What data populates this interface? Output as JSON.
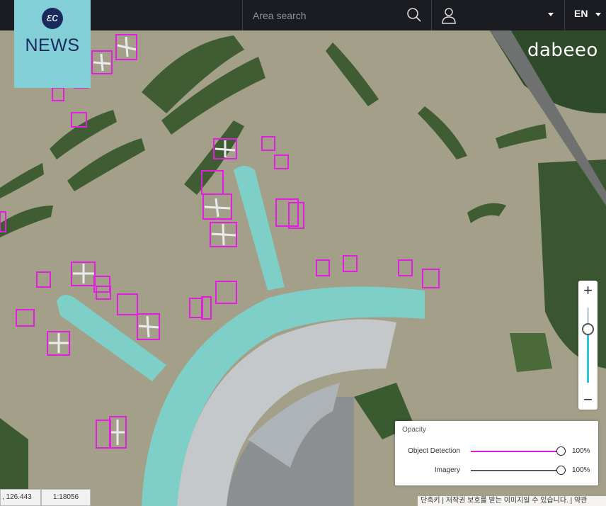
{
  "header": {
    "search_placeholder": "Area search",
    "language": "EN"
  },
  "news_badge": {
    "logo_text": "εc",
    "label": "NEWS"
  },
  "brand": {
    "name": "dabeeo"
  },
  "zoom": {
    "in_label": "+",
    "out_label": "−",
    "level": 0.72
  },
  "opacity_panel": {
    "title": "Opacity",
    "layers": [
      {
        "label": "Object Detection",
        "value_text": "100%",
        "value": 1.0,
        "color": "#d61ad6"
      },
      {
        "label": "Imagery",
        "value_text": "100%",
        "value": 1.0,
        "color": "#555b66"
      }
    ]
  },
  "status": {
    "coords": ", 126.443",
    "scale": "1:18056",
    "attribution": "단축키 | 저작권 보호를 받는 이미지일 수 있습니다. | 약관"
  },
  "colors": {
    "detection_box": "#e21fe0",
    "terminal": "#7ecfc8",
    "topbar": "#1a1c21",
    "news_bg": "#82cfd8"
  }
}
